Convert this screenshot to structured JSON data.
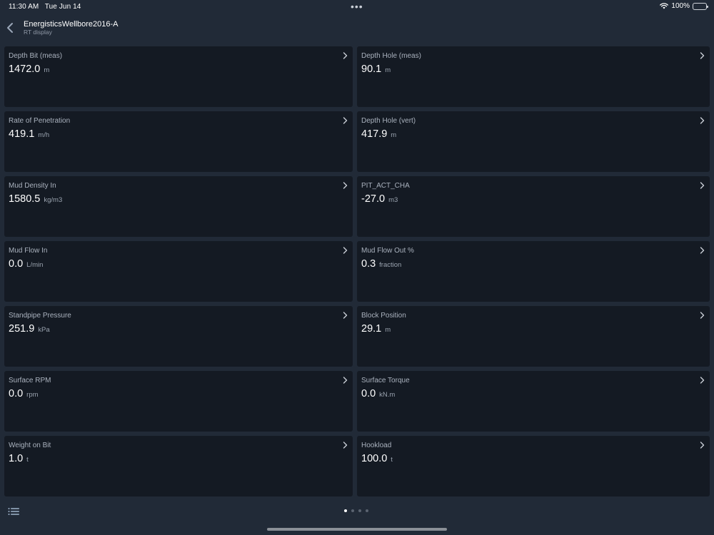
{
  "status_bar": {
    "time": "11:30 AM",
    "date": "Tue Jun 14",
    "multitask_dots": "•••",
    "battery_text": "100%"
  },
  "nav": {
    "title": "EnergisticsWellbore2016-A",
    "subtitle": "RT display"
  },
  "cards": [
    {
      "label": "Depth Bit (meas)",
      "value": "1472.0",
      "unit": "m"
    },
    {
      "label": "Depth Hole (meas)",
      "value": "90.1",
      "unit": "m"
    },
    {
      "label": "Rate of Penetration",
      "value": "419.1",
      "unit": "m/h"
    },
    {
      "label": "Depth Hole (vert)",
      "value": "417.9",
      "unit": "m"
    },
    {
      "label": "Mud Density In",
      "value": "1580.5",
      "unit": "kg/m3"
    },
    {
      "label": "PIT_ACT_CHA",
      "value": "-27.0",
      "unit": "m3"
    },
    {
      "label": "Mud Flow In",
      "value": "0.0",
      "unit": "L/min"
    },
    {
      "label": "Mud Flow Out %",
      "value": "0.3",
      "unit": "fraction"
    },
    {
      "label": "Standpipe Pressure",
      "value": "251.9",
      "unit": "kPa"
    },
    {
      "label": "Block Position",
      "value": "29.1",
      "unit": "m"
    },
    {
      "label": "Surface RPM",
      "value": "0.0",
      "unit": "rpm"
    },
    {
      "label": "Surface Torque",
      "value": "0.0",
      "unit": "kN.m"
    },
    {
      "label": "Weight on Bit",
      "value": "1.0",
      "unit": "t"
    },
    {
      "label": "Hookload",
      "value": "100.0",
      "unit": "t"
    }
  ],
  "pager": {
    "count": 4,
    "active_index": 0
  },
  "icons": {
    "back": "chevron-left-icon",
    "card": "chevron-right-icon",
    "list": "list-icon",
    "wifi": "wifi-icon",
    "battery": "battery-icon"
  },
  "colors": {
    "background": "#212a37",
    "card": "#141a23",
    "accent": "#ffffff"
  }
}
